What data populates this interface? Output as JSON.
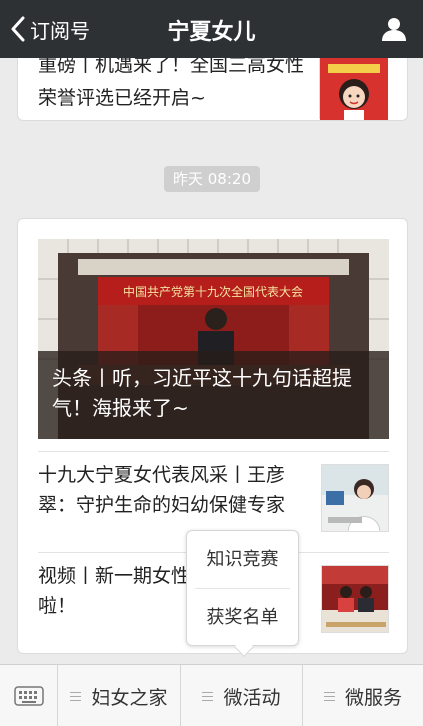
{
  "navbar": {
    "back_label": "订阅号",
    "title": "宁夏女儿",
    "profile_icon": "person-icon"
  },
  "feed": {
    "card_prev": {
      "text": "重磅丨机遇来了！全国三高女性荣誉评选已经开启~"
    },
    "time_label": "昨天 08:20",
    "card_main": {
      "hero_title": "头条丨听，习近平这十九句话超提气！海报来了~",
      "banner_text": "中国共产党第十九次全国代表大会",
      "items": [
        {
          "title": "十九大宁夏女代表风采丨王彦翠：守护生命的妇幼保健专家"
        },
        {
          "title": "视频丨新一期女性联播播出啦！"
        }
      ]
    }
  },
  "popup_menu": {
    "items": [
      "知识竞赛",
      "获奖名单"
    ]
  },
  "bottom_menu": {
    "keyboard_icon": "keyboard-icon",
    "items": [
      "妇女之家",
      "微活动",
      "微服务"
    ]
  },
  "colors": {
    "navbar_bg": "#2e3134",
    "page_bg": "#ebebeb",
    "accent_red": "#d8322f"
  }
}
